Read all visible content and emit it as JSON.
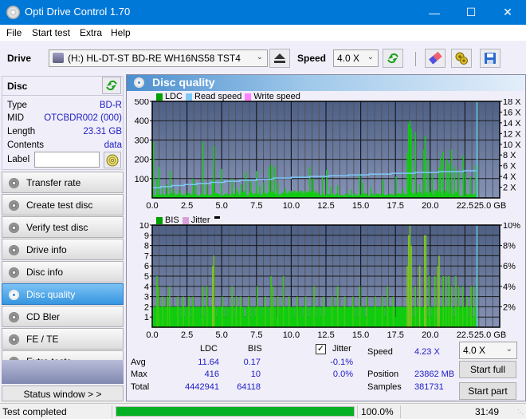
{
  "window": {
    "title": "Opti Drive Control 1.70",
    "minimize_glyph": "—",
    "maximize_glyph": "☐",
    "close_glyph": "✕"
  },
  "menu": [
    "File",
    "Start test",
    "Extra",
    "Help"
  ],
  "toolbar": {
    "drive_label": "Drive",
    "drive_value": "(H:)  HL-DT-ST BD-RE  WH16NS58 TST4",
    "speed_label": "Speed",
    "speed_value": "4.0 X",
    "icons": [
      "eject-icon",
      "refresh-icon",
      "erase-icon",
      "settings-icon",
      "save-icon"
    ]
  },
  "disc": {
    "header": "Disc",
    "rows": [
      {
        "key": "Type",
        "value": "BD-R"
      },
      {
        "key": "MID",
        "value": "OTCBDR002 (000)"
      },
      {
        "key": "Length",
        "value": "23.31 GB"
      },
      {
        "key": "Contents",
        "value": "data"
      }
    ],
    "label_key": "Label",
    "label_value": ""
  },
  "nav": [
    {
      "label": "Transfer rate",
      "active": false
    },
    {
      "label": "Create test disc",
      "active": false
    },
    {
      "label": "Verify test disc",
      "active": false
    },
    {
      "label": "Drive info",
      "active": false
    },
    {
      "label": "Disc info",
      "active": false
    },
    {
      "label": "Disc quality",
      "active": true
    },
    {
      "label": "CD Bler",
      "active": false
    },
    {
      "label": "FE / TE",
      "active": false
    },
    {
      "label": "Extra tests",
      "active": false
    }
  ],
  "status_window_button": "Status window > >",
  "panel": {
    "title": "Disc quality"
  },
  "colors": {
    "ldc": "#00a000",
    "bis": "#00a000",
    "read_speed": "#7ec8f8",
    "write_speed": "#ff80ff",
    "jitter": "#d8a0d8",
    "bar_green": "#10cc10",
    "plot_bg_top": "#4d5f86",
    "plot_bg_bottom": "#8593b6",
    "accent_blue": "#0078d7",
    "progress_green": "#06b025"
  },
  "chart_data": [
    {
      "type": "bar",
      "title": "LDC / Read speed",
      "legend": [
        "LDC",
        "Read speed",
        "Write speed"
      ],
      "xlabel": "GB",
      "x_ticks": [
        "0.0",
        "2.5",
        "5.0",
        "7.5",
        "10.0",
        "12.5",
        "15.0",
        "17.5",
        "20.0",
        "22.5",
        "25.0 GB"
      ],
      "xlim": [
        0,
        25
      ],
      "y_ticks": [
        "100",
        "200",
        "300",
        "400",
        "500"
      ],
      "ylim": [
        0,
        500
      ],
      "y2_ticks": [
        "2 X",
        "4 X",
        "6 X",
        "8 X",
        "10 X",
        "12 X",
        "14 X",
        "16 X",
        "18 X"
      ],
      "y2lim": [
        0,
        18
      ],
      "ldc_spikes": [
        [
          0.05,
          290
        ],
        [
          0.3,
          100
        ],
        [
          0.45,
          160
        ],
        [
          0.7,
          60
        ],
        [
          1.05,
          70
        ],
        [
          1.25,
          140
        ],
        [
          1.5,
          45
        ],
        [
          1.9,
          40
        ],
        [
          2.4,
          35
        ],
        [
          2.9,
          100
        ],
        [
          3.1,
          75
        ],
        [
          3.6,
          290
        ],
        [
          3.85,
          70
        ],
        [
          4.3,
          95
        ],
        [
          4.4,
          270
        ],
        [
          4.95,
          150
        ],
        [
          5.7,
          100
        ],
        [
          6.0,
          55
        ],
        [
          6.35,
          70
        ],
        [
          6.7,
          135
        ],
        [
          7.05,
          85
        ],
        [
          7.45,
          140
        ],
        [
          7.7,
          60
        ],
        [
          8.0,
          80
        ],
        [
          8.4,
          160
        ],
        [
          8.55,
          175
        ],
        [
          8.75,
          160
        ],
        [
          9.0,
          80
        ],
        [
          9.5,
          50
        ],
        [
          10.2,
          40
        ],
        [
          11.3,
          160
        ],
        [
          11.55,
          100
        ],
        [
          12.2,
          110
        ],
        [
          12.5,
          145
        ],
        [
          12.8,
          60
        ],
        [
          13.3,
          65
        ],
        [
          14.3,
          45
        ],
        [
          14.9,
          125
        ],
        [
          15.1,
          80
        ],
        [
          15.7,
          55
        ],
        [
          16.6,
          95
        ],
        [
          17.5,
          110
        ],
        [
          18.0,
          50
        ],
        [
          18.3,
          230
        ],
        [
          18.4,
          385
        ],
        [
          18.5,
          400
        ],
        [
          18.6,
          360
        ],
        [
          18.9,
          340
        ],
        [
          19.2,
          70
        ],
        [
          19.5,
          250
        ],
        [
          19.6,
          320
        ],
        [
          19.8,
          200
        ],
        [
          20.1,
          130
        ],
        [
          20.6,
          160
        ],
        [
          20.7,
          210
        ],
        [
          20.9,
          240
        ],
        [
          21.15,
          200
        ],
        [
          21.3,
          180
        ],
        [
          21.5,
          250
        ],
        [
          21.7,
          160
        ],
        [
          22.0,
          145
        ],
        [
          22.35,
          220
        ],
        [
          22.5,
          130
        ],
        [
          22.85,
          110
        ],
        [
          23.25,
          170
        ],
        [
          23.3,
          60
        ]
      ],
      "ldc_baseline": 20,
      "read_speed_steps": [
        [
          0.0,
          1.9
        ],
        [
          0.6,
          2.1
        ],
        [
          1.4,
          2.3
        ],
        [
          2.3,
          2.5
        ],
        [
          3.2,
          2.7
        ],
        [
          4.2,
          2.9
        ],
        [
          5.2,
          3.1
        ],
        [
          6.3,
          3.3
        ],
        [
          7.5,
          3.5
        ],
        [
          8.7,
          3.7
        ],
        [
          10.0,
          3.85
        ],
        [
          11.3,
          4.0
        ],
        [
          12.7,
          4.15
        ],
        [
          14.1,
          4.3
        ],
        [
          15.6,
          4.45
        ],
        [
          17.2,
          4.6
        ],
        [
          18.9,
          4.75
        ],
        [
          20.6,
          4.9
        ],
        [
          22.4,
          5.05
        ],
        [
          23.31,
          5.1
        ]
      ],
      "end_marker_gb": 23.31
    },
    {
      "type": "bar",
      "title": "BIS / Jitter",
      "legend": [
        "BIS",
        "Jitter"
      ],
      "xlabel": "GB",
      "x_ticks": [
        "0.0",
        "2.5",
        "5.0",
        "7.5",
        "10.0",
        "12.5",
        "15.0",
        "17.5",
        "20.0",
        "22.5",
        "25.0 GB"
      ],
      "xlim": [
        0,
        25
      ],
      "y_ticks": [
        "1",
        "2",
        "3",
        "4",
        "5",
        "6",
        "7",
        "8",
        "9",
        "10"
      ],
      "ylim": [
        0,
        10
      ],
      "y2_ticks": [
        "2%",
        "4%",
        "6%",
        "8%",
        "10%"
      ],
      "y2lim": [
        0,
        10
      ],
      "bis_baseline": 2,
      "bis_spikes": [
        [
          0.3,
          5
        ],
        [
          0.4,
          4
        ],
        [
          0.7,
          3
        ],
        [
          1.05,
          3
        ],
        [
          1.2,
          4
        ],
        [
          1.8,
          3
        ],
        [
          2.2,
          3
        ],
        [
          2.6,
          3
        ],
        [
          2.9,
          3
        ],
        [
          3.6,
          4
        ],
        [
          3.9,
          4
        ],
        [
          4.3,
          6
        ],
        [
          4.4,
          7
        ],
        [
          5.0,
          3
        ],
        [
          5.7,
          4
        ],
        [
          6.0,
          3
        ],
        [
          6.3,
          3
        ],
        [
          6.9,
          3
        ],
        [
          7.5,
          4
        ],
        [
          8.1,
          3
        ],
        [
          8.5,
          5
        ],
        [
          8.65,
          4
        ],
        [
          9.0,
          3
        ],
        [
          9.4,
          5
        ],
        [
          9.8,
          3
        ],
        [
          10.4,
          3
        ],
        [
          11.0,
          3
        ],
        [
          11.6,
          4
        ],
        [
          12.3,
          3
        ],
        [
          12.9,
          3
        ],
        [
          13.3,
          4
        ],
        [
          13.8,
          3
        ],
        [
          14.4,
          3
        ],
        [
          14.9,
          4
        ],
        [
          15.4,
          3
        ],
        [
          16.0,
          3
        ],
        [
          16.5,
          3
        ],
        [
          16.9,
          4
        ],
        [
          17.3,
          3
        ],
        [
          18.3,
          6
        ],
        [
          18.4,
          9
        ],
        [
          18.5,
          10
        ],
        [
          18.6,
          8
        ],
        [
          18.9,
          4
        ],
        [
          19.2,
          6
        ],
        [
          19.55,
          9
        ],
        [
          19.65,
          9
        ],
        [
          19.9,
          5
        ],
        [
          20.3,
          5
        ],
        [
          20.5,
          6
        ],
        [
          20.6,
          7
        ],
        [
          20.9,
          5
        ],
        [
          21.1,
          5
        ],
        [
          21.3,
          5
        ],
        [
          21.5,
          4
        ],
        [
          21.8,
          5
        ],
        [
          22.0,
          4
        ],
        [
          22.3,
          4
        ],
        [
          22.6,
          3
        ],
        [
          22.9,
          4
        ],
        [
          23.1,
          4
        ],
        [
          23.3,
          5
        ]
      ],
      "end_marker_gb": 23.31
    }
  ],
  "stats": {
    "col_ldc": "LDC",
    "col_bis": "BIS",
    "jitter_label": "Jitter",
    "jitter_checked": true,
    "rows": [
      {
        "label": "Avg",
        "ldc": "11.64",
        "bis": "0.17",
        "jitter": "-0.1%"
      },
      {
        "label": "Max",
        "ldc": "416",
        "bis": "10",
        "jitter": "0.0%"
      },
      {
        "label": "Total",
        "ldc": "4442941",
        "bis": "64118",
        "jitter": ""
      }
    ],
    "speed_label": "Speed",
    "speed_value": "4.23 X",
    "position_label": "Position",
    "position_value": "23862 MB",
    "samples_label": "Samples",
    "samples_value": "381731",
    "speed_select": "4.0 X",
    "start_full": "Start full",
    "start_part": "Start part"
  },
  "statusbar": {
    "text": "Test completed",
    "progress": 1.0,
    "progress_text": "100.0%",
    "time": "31:49"
  }
}
